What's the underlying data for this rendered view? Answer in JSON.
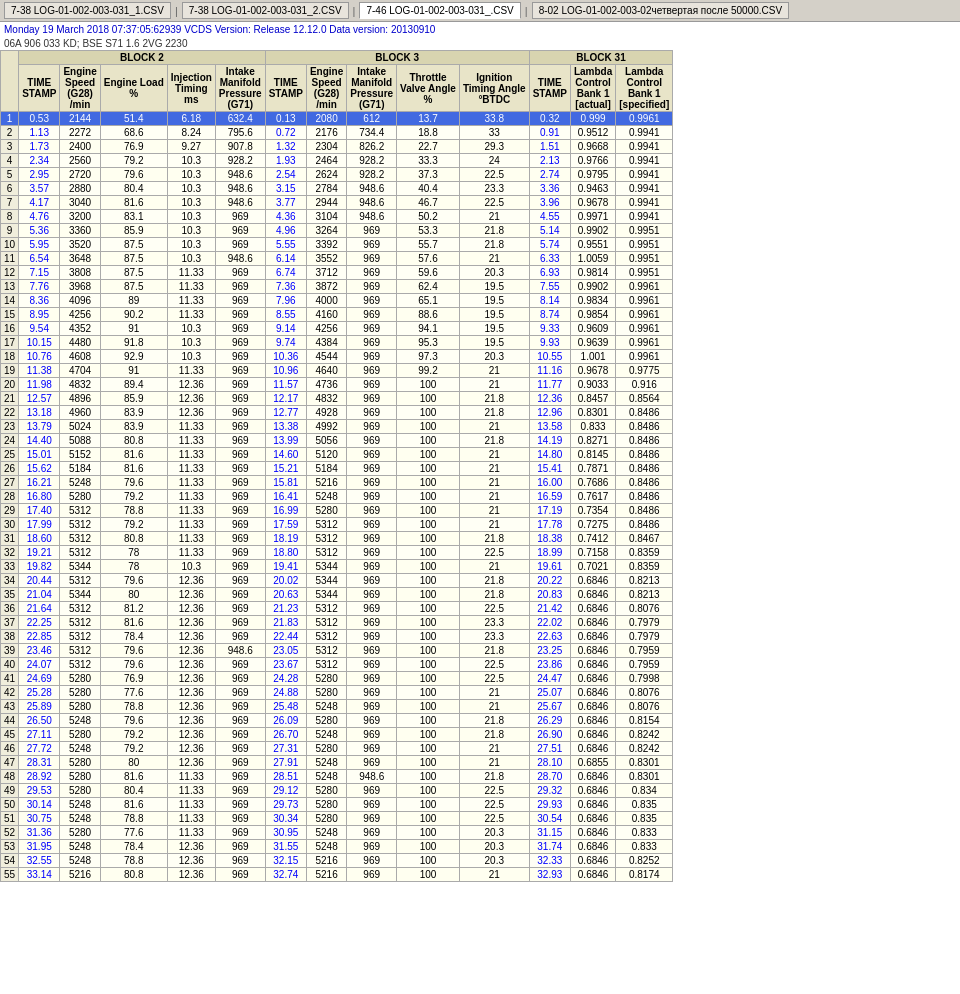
{
  "tabs": [
    {
      "label": "7-38 LOG-01-002-003-031_1.CSV",
      "active": false
    },
    {
      "label": "7-38 LOG-01-002-003-031_2.CSV",
      "active": false
    },
    {
      "label": "7-46 LOG-01-002-003-031_.CSV",
      "active": true
    },
    {
      "label": "8-02 LOG-01-002-003-02четвертая после 50000.CSV",
      "active": false
    }
  ],
  "info1": "Monday 19 March 2018 07:37:05:62939 VCDS Version: Release 12.12.0 Data version: 20130910",
  "info2": "06A 906 033 KD; BSE S71 1.6 2VG   2230",
  "block2_header": "BLOCK 2",
  "block3_header": "BLOCK 3",
  "block31_header": "BLOCK 31",
  "col_headers": {
    "row_num": "",
    "b2_ts": "TIME STAMP",
    "b2_es": "Engine Speed (G28) /min",
    "b2_el": "Engine Load %",
    "b2_it": "Injection Timing ms",
    "b2_imp": "Intake Manifold Pressure (G71)",
    "b3_ts": "TIME STAMP",
    "b3_es": "Engine Speed (G28) /min",
    "b3_imp": "Intake Manifold Pressure (G71)",
    "b3_tva": "Throttle Valve Angle %",
    "b3_ita": "Ignition Timing Angle °BTDC",
    "b31_ts": "TIME STAMP",
    "b31_lcb1a": "Lambda Control Bank 1 [actual]",
    "b31_lcb1s": "Lambda Control Bank 1 [specified]"
  },
  "rows": [
    [
      1,
      "0.53",
      2144,
      51.4,
      6.18,
      632.4,
      "0.13",
      2080,
      612.0,
      13.7,
      33.8,
      "0.32",
      0.999,
      0.9961
    ],
    [
      2,
      "1.13",
      2272,
      68.6,
      8.24,
      795.6,
      "0.72",
      2176,
      734.4,
      18.8,
      33.0,
      "0.91",
      0.9512,
      0.9941
    ],
    [
      3,
      "1.73",
      2400,
      76.9,
      9.27,
      907.8,
      "1.32",
      2304,
      826.2,
      22.7,
      29.3,
      "1.51",
      0.9668,
      0.9941
    ],
    [
      4,
      "2.34",
      2560,
      79.2,
      10.3,
      928.2,
      "1.93",
      2464,
      928.2,
      33.3,
      24.0,
      "2.13",
      0.9766,
      0.9941
    ],
    [
      5,
      "2.95",
      2720,
      79.6,
      10.3,
      948.6,
      "2.54",
      2624,
      928.2,
      37.3,
      22.5,
      "2.74",
      0.9795,
      0.9941
    ],
    [
      6,
      "3.57",
      2880,
      80.4,
      10.3,
      948.6,
      "3.15",
      2784,
      948.6,
      40.4,
      23.3,
      "3.36",
      0.9463,
      0.9941
    ],
    [
      7,
      "4.17",
      3040,
      81.6,
      10.3,
      948.6,
      "3.77",
      2944,
      948.6,
      46.7,
      22.5,
      "3.96",
      0.9678,
      0.9941
    ],
    [
      8,
      "4.76",
      3200,
      83.1,
      10.3,
      969.0,
      "4.36",
      3104,
      948.6,
      50.2,
      21.0,
      "4.55",
      0.9971,
      0.9941
    ],
    [
      9,
      "5.36",
      3360,
      85.9,
      10.3,
      969.0,
      "4.96",
      3264,
      969.0,
      53.3,
      21.8,
      "5.14",
      0.9902,
      0.9951
    ],
    [
      10,
      "5.95",
      3520,
      87.5,
      10.3,
      969.0,
      "5.55",
      3392,
      969.0,
      55.7,
      21.8,
      "5.74",
      0.9551,
      0.9951
    ],
    [
      11,
      "6.54",
      3648,
      87.5,
      10.3,
      948.6,
      "6.14",
      3552,
      969.0,
      57.6,
      21.0,
      "6.33",
      1.0059,
      0.9951
    ],
    [
      12,
      "7.15",
      3808,
      87.5,
      11.33,
      969.0,
      "6.74",
      3712,
      969.0,
      59.6,
      20.3,
      "6.93",
      0.9814,
      0.9951
    ],
    [
      13,
      "7.76",
      3968,
      87.5,
      11.33,
      969.0,
      "7.36",
      3872,
      969.0,
      62.4,
      19.5,
      "7.55",
      0.9902,
      0.9961
    ],
    [
      14,
      "8.36",
      4096,
      89.0,
      11.33,
      969.0,
      "7.96",
      4000,
      969.0,
      65.1,
      19.5,
      "8.14",
      0.9834,
      0.9961
    ],
    [
      15,
      "8.95",
      4256,
      90.2,
      11.33,
      969.0,
      "8.55",
      4160,
      969.0,
      88.6,
      19.5,
      "8.74",
      0.9854,
      0.9961
    ],
    [
      16,
      "9.54",
      4352,
      91.0,
      10.3,
      969.0,
      "9.14",
      4256,
      969.0,
      94.1,
      19.5,
      "9.33",
      0.9609,
      0.9961
    ],
    [
      17,
      "10.15",
      4480,
      91.8,
      10.3,
      969.0,
      "9.74",
      4384,
      969.0,
      95.3,
      19.5,
      "9.93",
      0.9639,
      0.9961
    ],
    [
      18,
      "10.76",
      4608,
      92.9,
      10.3,
      969.0,
      "10.36",
      4544,
      969.0,
      97.3,
      20.3,
      "10.55",
      1.001,
      0.9961
    ],
    [
      19,
      "11.38",
      4704,
      91.0,
      11.33,
      969.0,
      "10.96",
      4640,
      969.0,
      99.2,
      21.0,
      "11.16",
      0.9678,
      0.9775
    ],
    [
      20,
      "11.98",
      4832,
      89.4,
      12.36,
      969.0,
      "11.57",
      4736,
      969.0,
      100.0,
      21.0,
      "11.77",
      0.9033,
      0.916
    ],
    [
      21,
      "12.57",
      4896,
      85.9,
      12.36,
      969.0,
      "12.17",
      4832,
      969.0,
      100.0,
      21.8,
      "12.36",
      0.8457,
      0.8564
    ],
    [
      22,
      "13.18",
      4960,
      83.9,
      12.36,
      969.0,
      "12.77",
      4928,
      969.0,
      100.0,
      21.8,
      "12.96",
      0.8301,
      0.8486
    ],
    [
      23,
      "13.79",
      5024,
      83.9,
      11.33,
      969.0,
      "13.38",
      4992,
      969.0,
      100.0,
      21.0,
      "13.58",
      0.833,
      0.8486
    ],
    [
      24,
      "14.40",
      5088,
      80.8,
      11.33,
      969.0,
      "13.99",
      5056,
      969.0,
      100.0,
      21.8,
      "14.19",
      0.8271,
      0.8486
    ],
    [
      25,
      "15.01",
      5152,
      81.6,
      11.33,
      969.0,
      "14.60",
      5120,
      969.0,
      100.0,
      21.0,
      "14.80",
      0.8145,
      0.8486
    ],
    [
      26,
      "15.62",
      5184,
      81.6,
      11.33,
      969.0,
      "15.21",
      5184,
      969.0,
      100.0,
      21.0,
      "15.41",
      0.7871,
      0.8486
    ],
    [
      27,
      "16.21",
      5248,
      79.6,
      11.33,
      969.0,
      "15.81",
      5216,
      969.0,
      100.0,
      21.0,
      "16.00",
      0.7686,
      0.8486
    ],
    [
      28,
      "16.80",
      5280,
      79.2,
      11.33,
      969.0,
      "16.41",
      5248,
      969.0,
      100.0,
      21.0,
      "16.59",
      0.7617,
      0.8486
    ],
    [
      29,
      "17.40",
      5312,
      78.8,
      11.33,
      969.0,
      "16.99",
      5280,
      969.0,
      100.0,
      21.0,
      "17.19",
      0.7354,
      0.8486
    ],
    [
      30,
      "17.99",
      5312,
      79.2,
      11.33,
      969.0,
      "17.59",
      5312,
      969.0,
      100.0,
      21.0,
      "17.78",
      0.7275,
      0.8486
    ],
    [
      31,
      "18.60",
      5312,
      80.8,
      11.33,
      969.0,
      "18.19",
      5312,
      969.0,
      100.0,
      21.8,
      "18.38",
      0.7412,
      0.8467
    ],
    [
      32,
      "19.21",
      5312,
      78.0,
      11.33,
      969.0,
      "18.80",
      5312,
      969.0,
      100.0,
      22.5,
      "18.99",
      0.7158,
      0.8359
    ],
    [
      33,
      "19.82",
      5344,
      78.0,
      10.3,
      969.0,
      "19.41",
      5344,
      969.0,
      100.0,
      21.0,
      "19.61",
      0.7021,
      0.8359
    ],
    [
      34,
      "20.44",
      5312,
      79.6,
      12.36,
      969.0,
      "20.02",
      5344,
      969.0,
      100.0,
      21.8,
      "20.22",
      0.6846,
      0.8213
    ],
    [
      35,
      "21.04",
      5344,
      80.0,
      12.36,
      969.0,
      "20.63",
      5344,
      969.0,
      100.0,
      21.8,
      "20.83",
      0.6846,
      0.8213
    ],
    [
      36,
      "21.64",
      5312,
      81.2,
      12.36,
      969.0,
      "21.23",
      5312,
      969.0,
      100.0,
      22.5,
      "21.42",
      0.6846,
      0.8076
    ],
    [
      37,
      "22.25",
      5312,
      81.6,
      12.36,
      969.0,
      "21.83",
      5312,
      969.0,
      100.0,
      23.3,
      "22.02",
      0.6846,
      0.7979
    ],
    [
      38,
      "22.85",
      5312,
      78.4,
      12.36,
      969.0,
      "22.44",
      5312,
      969.0,
      100.0,
      23.3,
      "22.63",
      0.6846,
      0.7979
    ],
    [
      39,
      "23.46",
      5312,
      79.6,
      12.36,
      948.6,
      "23.05",
      5312,
      969.0,
      100.0,
      21.8,
      "23.25",
      0.6846,
      0.7959
    ],
    [
      40,
      "24.07",
      5312,
      79.6,
      12.36,
      969.0,
      "23.67",
      5312,
      969.0,
      100.0,
      22.5,
      "23.86",
      0.6846,
      0.7959
    ],
    [
      41,
      "24.69",
      5280,
      76.9,
      12.36,
      969.0,
      "24.28",
      5280,
      969.0,
      100.0,
      22.5,
      "24.47",
      0.6846,
      0.7998
    ],
    [
      42,
      "25.28",
      5280,
      77.6,
      12.36,
      969.0,
      "24.88",
      5280,
      969.0,
      100.0,
      21.0,
      "25.07",
      0.6846,
      0.8076
    ],
    [
      43,
      "25.89",
      5280,
      78.8,
      12.36,
      969.0,
      "25.48",
      5248,
      969.0,
      100.0,
      21.0,
      "25.67",
      0.6846,
      0.8076
    ],
    [
      44,
      "26.50",
      5248,
      79.6,
      12.36,
      969.0,
      "26.09",
      5280,
      969.0,
      100.0,
      21.8,
      "26.29",
      0.6846,
      0.8154
    ],
    [
      45,
      "27.11",
      5280,
      79.2,
      12.36,
      969.0,
      "26.70",
      5248,
      969.0,
      100.0,
      21.8,
      "26.90",
      0.6846,
      0.8242
    ],
    [
      46,
      "27.72",
      5248,
      79.2,
      12.36,
      969.0,
      "27.31",
      5280,
      969.0,
      100.0,
      21.0,
      "27.51",
      0.6846,
      0.8242
    ],
    [
      47,
      "28.31",
      5280,
      80.0,
      12.36,
      969.0,
      "27.91",
      5248,
      969.0,
      100.0,
      21.0,
      "28.10",
      0.6855,
      0.8301
    ],
    [
      48,
      "28.92",
      5280,
      81.6,
      11.33,
      969.0,
      "28.51",
      5248,
      948.6,
      100.0,
      21.8,
      "28.70",
      0.6846,
      0.8301
    ],
    [
      49,
      "29.53",
      5280,
      80.4,
      11.33,
      969.0,
      "29.12",
      5280,
      969.0,
      100.0,
      22.5,
      "29.32",
      0.6846,
      0.834
    ],
    [
      50,
      "30.14",
      5248,
      81.6,
      11.33,
      969.0,
      "29.73",
      5280,
      969.0,
      100.0,
      22.5,
      "29.93",
      0.6846,
      0.835
    ],
    [
      51,
      "30.75",
      5248,
      78.8,
      11.33,
      969.0,
      "30.34",
      5280,
      969.0,
      100.0,
      22.5,
      "30.54",
      0.6846,
      0.835
    ],
    [
      52,
      "31.36",
      5280,
      77.6,
      11.33,
      969.0,
      "30.95",
      5248,
      969.0,
      100.0,
      20.3,
      "31.15",
      0.6846,
      0.833
    ],
    [
      53,
      "31.95",
      5248,
      78.4,
      12.36,
      969.0,
      "31.55",
      5248,
      969.0,
      100.0,
      20.3,
      "31.74",
      0.6846,
      0.833
    ],
    [
      54,
      "32.55",
      5248,
      78.8,
      12.36,
      969.0,
      "32.15",
      5216,
      969.0,
      100.0,
      20.3,
      "32.33",
      0.6846,
      0.8252
    ],
    [
      55,
      "33.14",
      5216,
      80.8,
      12.36,
      969.0,
      "32.74",
      5216,
      969.0,
      100.0,
      21.0,
      "32.93",
      0.6846,
      0.8174
    ]
  ]
}
